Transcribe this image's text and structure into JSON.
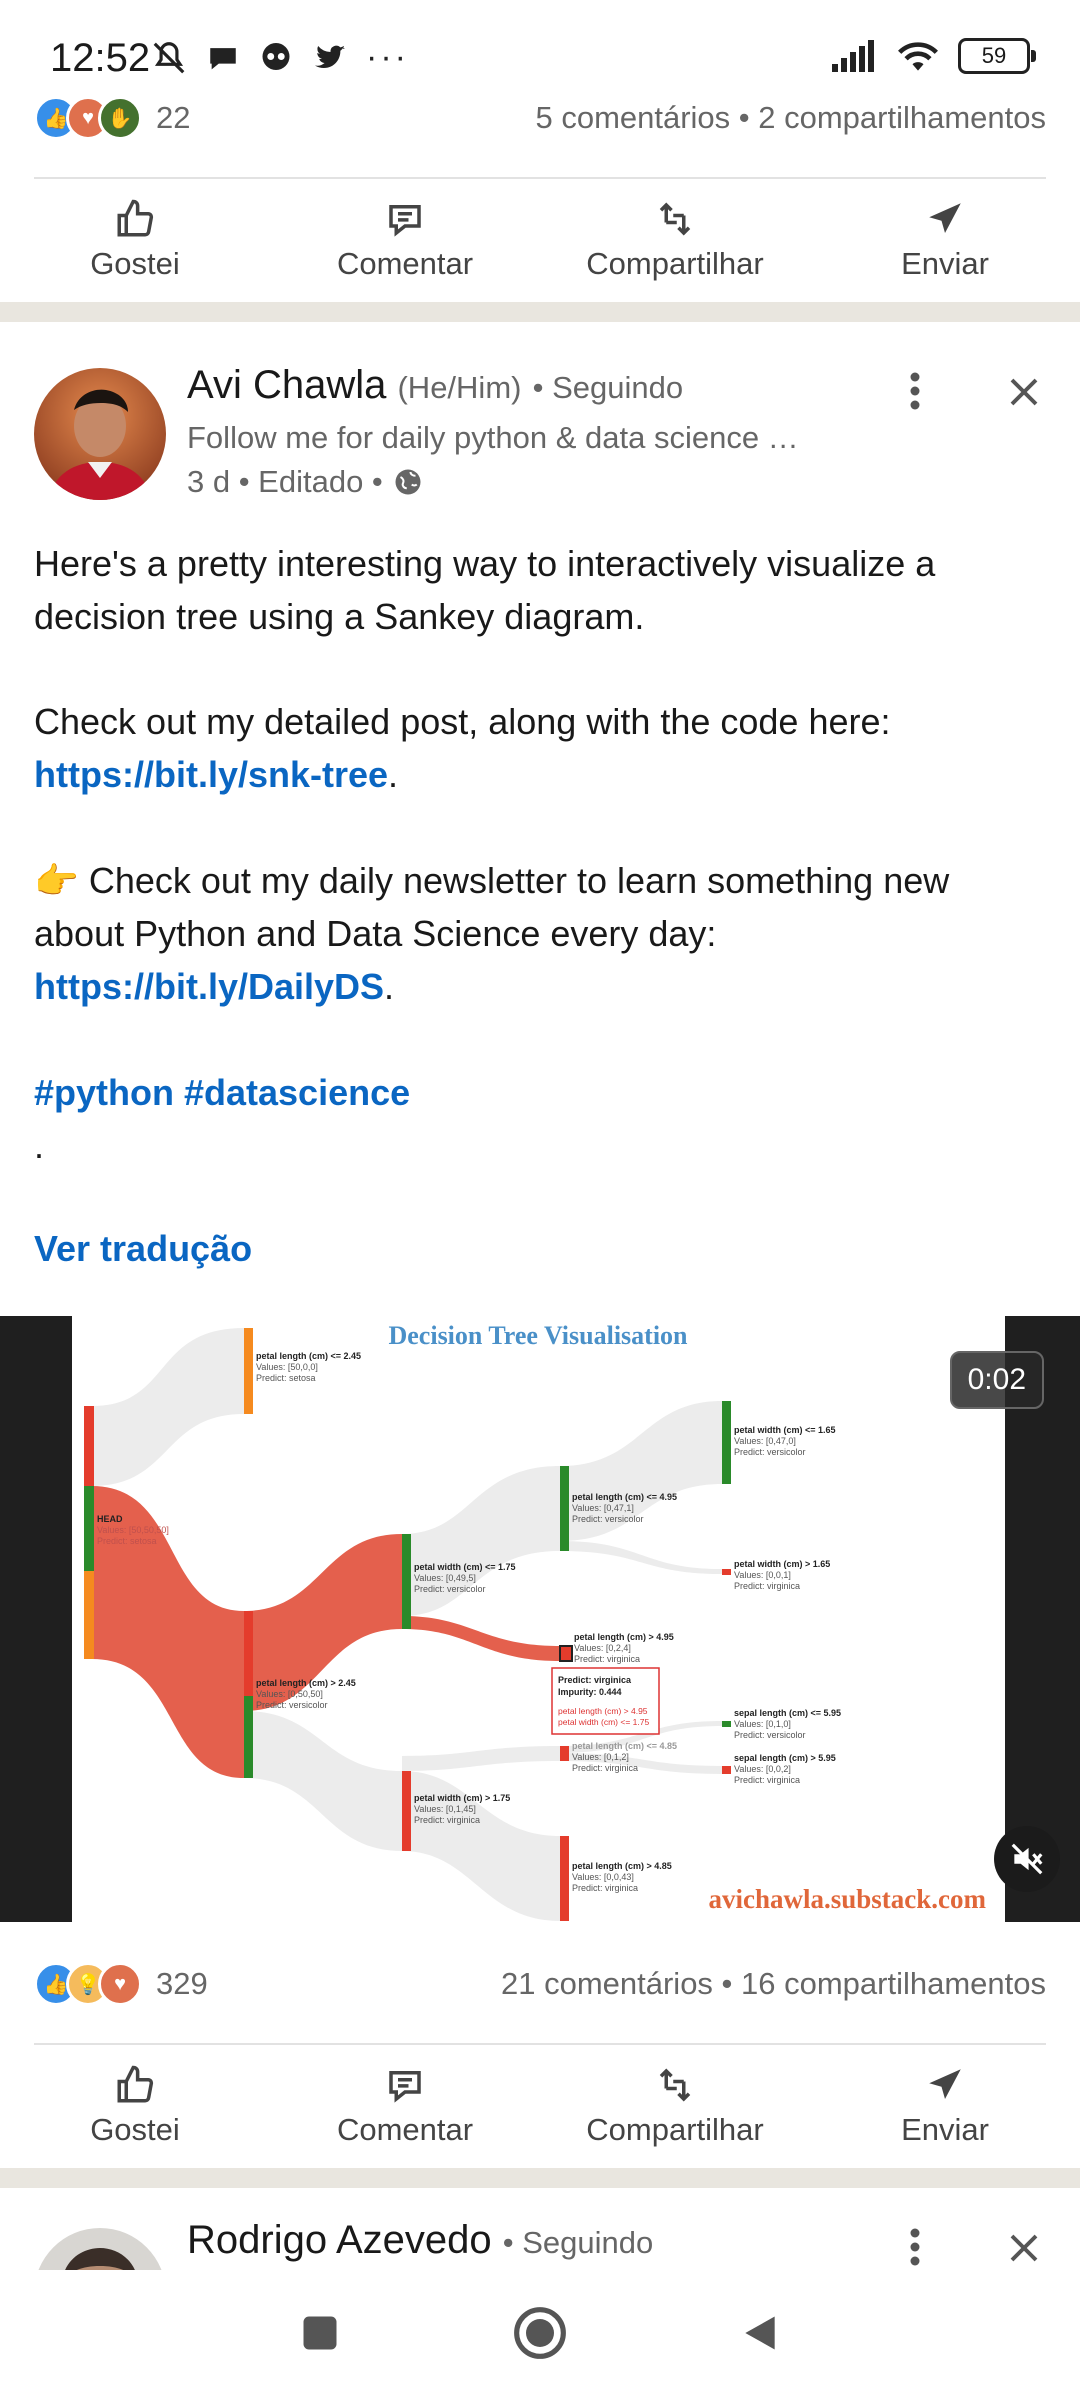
{
  "status_bar": {
    "time": "12:52",
    "battery": "59"
  },
  "prev_post": {
    "reactions_count": "22",
    "comments_shares": "5 comentários • 2 compartilhamentos"
  },
  "actions": {
    "like": "Gostei",
    "comment": "Comentar",
    "share": "Compartilhar",
    "send": "Enviar"
  },
  "post": {
    "author": "Avi Chawla",
    "pronouns": "(He/Him)",
    "follow_status": "• Seguindo",
    "headline": "Follow me for daily python & data science …",
    "meta": "3 d • Editado •",
    "text": {
      "p1": "Here's a pretty interesting way to interactively visualize a decision tree using a Sankey diagram.",
      "p2_prefix": "Check out my detailed post, along with the code here: ",
      "p2_link": "https://bit.ly/snk-tree",
      "p2_suffix": ".",
      "p3_emoji": "👉",
      "p3_prefix": " Check out my daily newsletter to learn something new about Python and Data Science every day: ",
      "p3_link": "https://bit.ly/DailyDS",
      "p3_suffix": ".",
      "hashtags": "#python #datascience",
      "dot": "."
    },
    "translate": "Ver tradução",
    "media": {
      "title": "Decision Tree Visualisation",
      "watermark": "avichawla.substack.com",
      "timer": "0:02",
      "nodes": {
        "head": {
          "label": "HEAD",
          "values": "Values: [50,50,50]",
          "predict": "Predict: setosa"
        },
        "n1": {
          "cond": "petal length (cm) <= 2.45",
          "values": "Values: [50,0,0]",
          "predict": "Predict: setosa"
        },
        "n2": {
          "cond": "petal length (cm) > 2.45",
          "values": "Values: [0,50,50]",
          "predict": "Predict: versicolor"
        },
        "n3": {
          "cond": "petal width (cm) <= 1.75",
          "values": "Values: [0,49,5]",
          "predict": "Predict: versicolor"
        },
        "n4": {
          "cond": "petal width (cm) > 1.75",
          "values": "Values: [0,1,45]",
          "predict": "Predict: virginica"
        },
        "n5": {
          "cond": "petal length (cm) <= 4.95",
          "values": "Values: [0,47,1]",
          "predict": "Predict: versicolor"
        },
        "n6": {
          "cond": "petal length (cm) > 4.95",
          "values": "Values: [0,2,4]",
          "predict": "Predict: virginica"
        },
        "n7": {
          "cond": "petal length (cm) > 4.85",
          "values": "Values: [0,0,43]",
          "predict": "Predict: virginica"
        },
        "n8": {
          "cond": "petal width (cm) <= 1.65",
          "values": "Values: [0,47,0]",
          "predict": "Predict: versicolor"
        },
        "n9": {
          "cond": "petal width (cm) > 1.65",
          "values": "Values: [0,0,1]",
          "predict": "Predict: virginica"
        },
        "n10": {
          "cond": "sepal length (cm) <= 5.95",
          "values": "Values: [0,1,0]",
          "predict": "Predict: versicolor"
        },
        "n11": {
          "cond": "sepal length (cm) > 5.95",
          "values": "Values: [0,0,2]",
          "predict": "Predict: virginica"
        },
        "n12": {
          "cond": "petal length (cm) <= 4.85",
          "values": "Values: [0,1,2]",
          "predict": "Predict: virginica"
        }
      },
      "tooltip": {
        "predict": "Predict: virginica",
        "impurity": "Impurity: 0.444",
        "rule1": "petal length (cm) > 4.95",
        "rule2": "petal width (cm) <= 1.75"
      }
    },
    "reactions_count": "329",
    "comments_shares": "21 comentários • 16 compartilhamentos"
  },
  "next_post": {
    "author": "Rodrigo Azevedo",
    "follow_status": "• Seguindo"
  }
}
